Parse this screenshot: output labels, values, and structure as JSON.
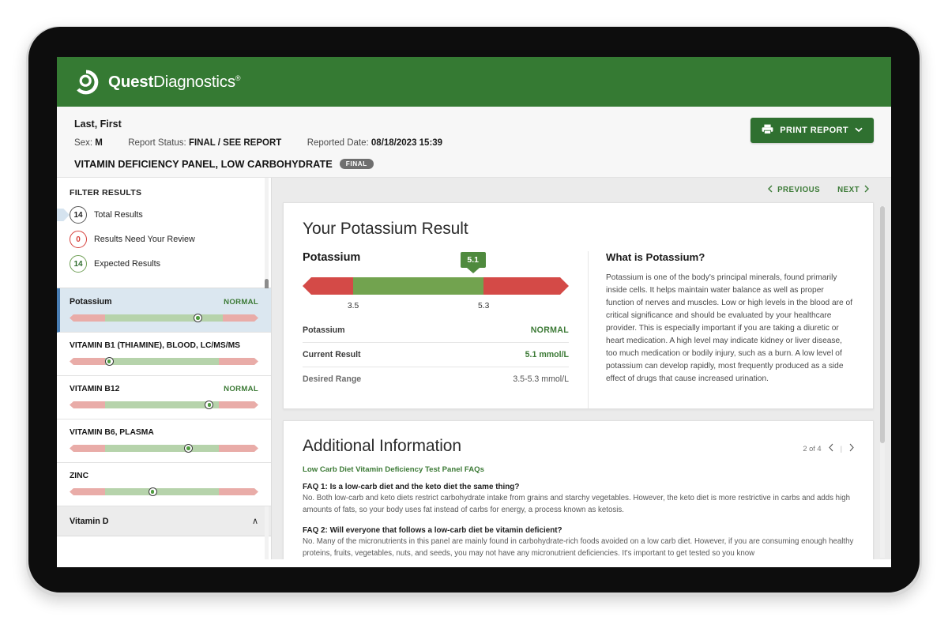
{
  "brand": {
    "name_bold": "Quest",
    "name_light": "Diagnostics",
    "trademark": "®",
    "logo_icon": "quest-swirl-logo",
    "bar_color": "#357a33"
  },
  "patient": {
    "name": "Last, First",
    "sex_label": "Sex:",
    "sex_value": "M",
    "status_label": "Report Status:",
    "status_value": "FINAL / SEE REPORT",
    "reported_label": "Reported Date:",
    "reported_value": "08/18/2023 15:39",
    "panel_title": "VITAMIN DEFICIENCY PANEL, LOW CARBOHYDRATE",
    "panel_badge": "FINAL"
  },
  "toolbar": {
    "print_label": "PRINT REPORT",
    "print_icon": "printer-icon",
    "print_chevron": "⌄"
  },
  "sidebar": {
    "filter_title": "FILTER RESULTS",
    "filters": [
      {
        "count": "14",
        "label": "Total Results",
        "style": "dark",
        "selected": true
      },
      {
        "count": "0",
        "label": "Results Need Your Review",
        "style": "red",
        "selected": false
      },
      {
        "count": "14",
        "label": "Expected Results",
        "style": "green",
        "selected": false
      }
    ],
    "results": [
      {
        "name": "Potassium",
        "status": "NORMAL",
        "marker_pct": 68,
        "low_pct": 19,
        "high_pct": 81,
        "selected": true
      },
      {
        "name": "VITAMIN B1 (THIAMINE), BLOOD, LC/MS/MS",
        "status": "",
        "marker_pct": 21,
        "low_pct": 19,
        "high_pct": 79,
        "selected": false
      },
      {
        "name": "VITAMIN B12",
        "status": "NORMAL",
        "marker_pct": 74,
        "low_pct": 19,
        "high_pct": 79,
        "selected": false
      },
      {
        "name": "VITAMIN B6, PLASMA",
        "status": "",
        "marker_pct": 63,
        "low_pct": 19,
        "high_pct": 79,
        "selected": false
      },
      {
        "name": "ZINC",
        "status": "",
        "marker_pct": 44,
        "low_pct": 19,
        "high_pct": 79,
        "selected": false
      }
    ],
    "group": {
      "label": "Vitamin D",
      "chevron": "∧"
    }
  },
  "main": {
    "nav": {
      "previous": "PREVIOUS",
      "next": "NEXT",
      "prev_icon": "chevron-left-icon",
      "next_icon": "chevron-right-icon"
    },
    "result_card": {
      "title": "Your Potassium Result",
      "analyte": "Potassium",
      "gauge": {
        "value_label": "5.1",
        "low_tick": "3.5",
        "high_tick": "5.3",
        "low_pct": 19,
        "high_pct": 68,
        "marker_pct": 64,
        "green_color": "#72a34f",
        "red_color": "#d44a47"
      },
      "rows": [
        {
          "label": "Potassium",
          "value": "NORMAL",
          "kind": "status"
        },
        {
          "label": "Current Result",
          "value": "5.1 mmol/L",
          "kind": "green"
        },
        {
          "label": "Desired Range",
          "value": "3.5-5.3 mmol/L",
          "kind": "plain"
        }
      ],
      "about_title": "What is Potassium?",
      "about_body": "Potassium is one of the body's principal minerals, found primarily inside cells. It helps maintain water balance as well as proper function of nerves and muscles. Low or high levels in the blood are of critical significance and should be evaluated by your healthcare provider. This is especially important if you are taking a diuretic or heart medication. A high level may indicate kidney or liver disease, too much medication or bodily injury, such as a burn. A low level of potassium can develop rapidly, most frequently produced as a side effect of drugs that cause increased urination."
    },
    "additional": {
      "title": "Additional Information",
      "page_indicator": "2 of 4",
      "prev_icon": "chevron-left-icon",
      "next_icon": "chevron-right-icon",
      "separator": "|",
      "category": "Low Carb Diet Vitamin Deficiency Test Panel FAQs",
      "faqs": [
        {
          "question": "FAQ 1: Is a low-carb diet and the keto diet the same thing?",
          "answer": "No. Both low-carb and keto diets restrict carbohydrate intake from grains and starchy vegetables. However, the keto diet is more restrictive in carbs and adds high amounts of fats, so your body uses fat instead of carbs for energy, a process known as ketosis."
        },
        {
          "question": "FAQ 2: Will everyone that follows a low-carb diet be vitamin deficient?",
          "answer": "No. Many of the micronutrients in this panel are mainly found in carbohydrate-rich foods avoided on a low carb diet. However, if you are consuming enough healthy proteins, fruits, vegetables, nuts, and seeds, you may not have any micronutrient deficiencies. It's important to get tested so you know"
        }
      ]
    }
  }
}
